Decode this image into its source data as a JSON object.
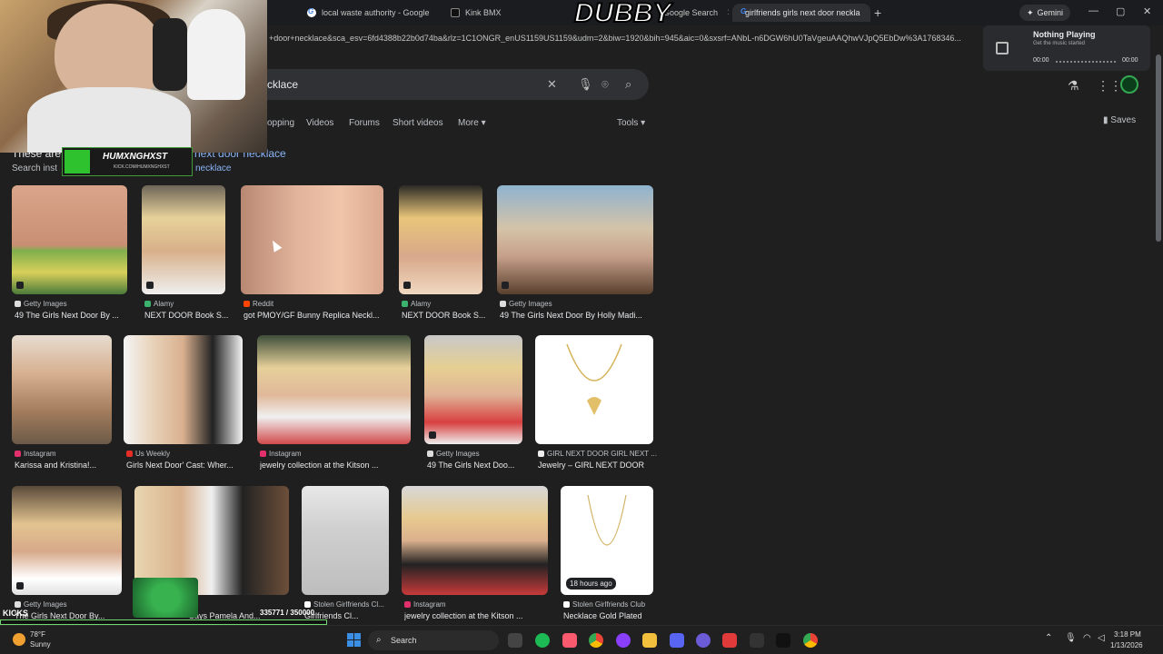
{
  "browser": {
    "tabs": [
      {
        "title": "local waste authority - Google",
        "icon": "google-icon"
      },
      {
        "title": "Kink BMX",
        "icon": "kink-icon"
      },
      {
        "title": "Google Search",
        "icon": "google-icon"
      },
      {
        "title": "girlfriends girls next door neckla",
        "icon": "google-icon",
        "active": true
      }
    ],
    "new_tab": "+",
    "gemini_label": "Gemini",
    "url": "+door+necklace&sca_esv=6fd4388b22b0d74ba&rlz=1C1ONGR_enUS1159US1159&udm=2&biw=1920&bih=945&aic=0&sxsrf=ANbL-n6DGW6hU0TaVgeuAAQhwVJpQ5EbDw%3A1768346..."
  },
  "media": {
    "title": "Nothing Playing",
    "subtitle": "Get the music started",
    "time_start": "00:00",
    "time_end": "00:00"
  },
  "google": {
    "query_visible": "cklace",
    "filters": [
      "opping",
      "Videos",
      "Forums",
      "Short videos",
      "More"
    ],
    "tools": "Tools",
    "saves": "Saves",
    "info_text": "These are",
    "info_link": "next door necklace",
    "search_inst": "Search inst",
    "search_inst_link": "necklace"
  },
  "results": [
    {
      "source": "Getty Images",
      "caption": "49 The Girls Next Door By ..."
    },
    {
      "source": "Alamy",
      "caption": "NEXT DOOR Book S..."
    },
    {
      "source": "Reddit",
      "caption": "got PMOY/GF Bunny Replica Neckl..."
    },
    {
      "source": "Alamy",
      "caption": "NEXT DOOR Book S..."
    },
    {
      "source": "Getty Images",
      "caption": "49 The Girls Next Door By Holly Madi..."
    },
    {
      "source": "Instagram",
      "caption": "Karissa and Kristina!..."
    },
    {
      "source": "Us Weekly",
      "caption": "Girls Next Door' Cast: Wher..."
    },
    {
      "source": "Instagram",
      "caption": "jewelry collection at the Kitson ..."
    },
    {
      "source": "Getty Images",
      "caption": "49 The Girls Next Doo..."
    },
    {
      "source": "GIRL NEXT DOOR GIRL NEXT ...",
      "caption": "Jewelry – GIRL NEXT DOOR"
    },
    {
      "source": "Getty Images",
      "caption": "The Girls Next Door By..."
    },
    {
      "source": "",
      "caption": "Says Pamela And..."
    },
    {
      "source": "Stolen Girlfriends Cl...",
      "caption": "Girlfriends Cl..."
    },
    {
      "source": "Instagram",
      "caption": "jewelry collection at the Kitson ..."
    },
    {
      "source": "Stolen Girlfriends Club",
      "caption": "Necklace Gold Plated",
      "badge": "18 hours ago"
    }
  ],
  "overlays": {
    "dubby": "DUBBY",
    "nametag": "HUMXNGHXST",
    "nametag_sub": "KICK.COM/HUMXNGHXST",
    "kicks_label": "KICKS",
    "counter": "335771 / 350000"
  },
  "taskbar": {
    "temp": "78°F",
    "weather": "Sunny",
    "search": "Search",
    "time": "3:18 PM",
    "date": "1/13/2026"
  }
}
